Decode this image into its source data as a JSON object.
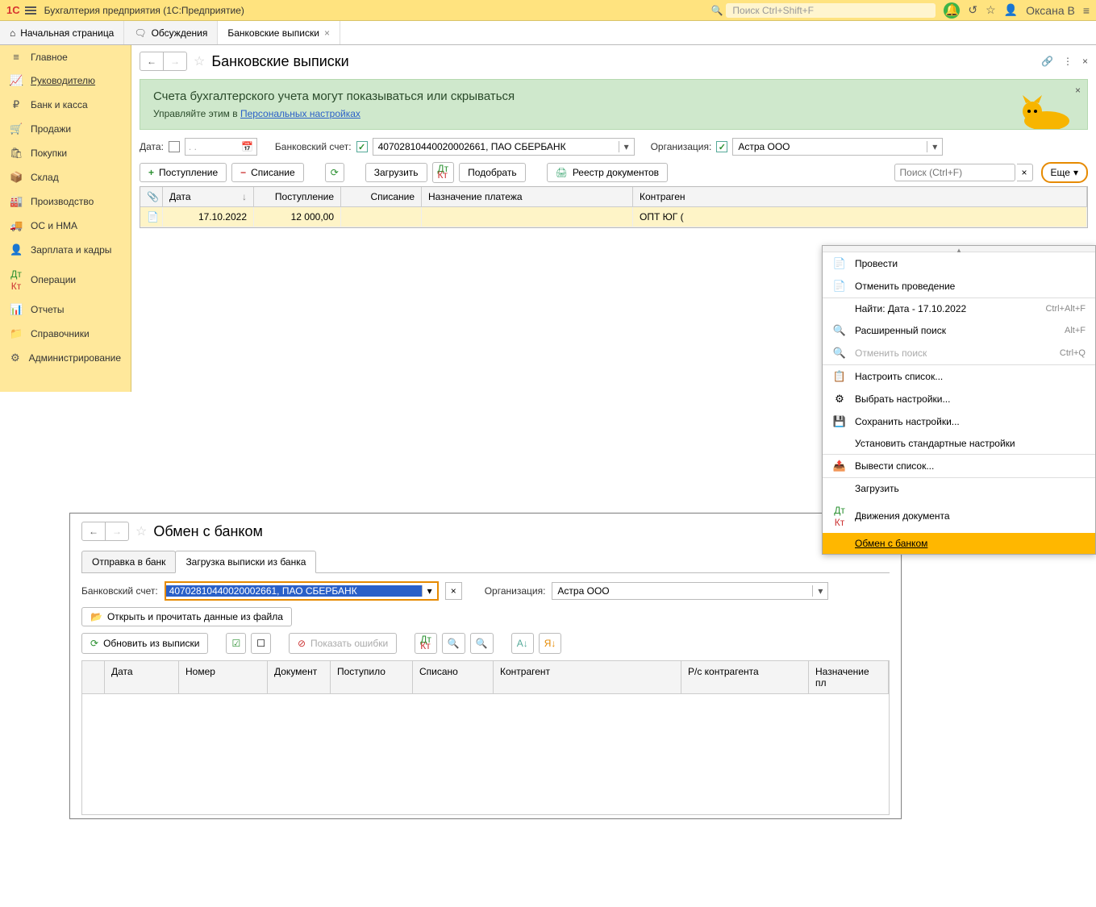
{
  "titlebar": {
    "app": "Бухгалтерия предприятия  (1С:Предприятие)",
    "search_placeholder": "Поиск Ctrl+Shift+F",
    "user": "Оксана В"
  },
  "tabs": {
    "start": "Начальная страница",
    "talk": "Обсуждения",
    "bank": "Банковские выписки"
  },
  "sidebar": {
    "items": [
      "Главное",
      "Руководителю",
      "Банк и касса",
      "Продажи",
      "Покупки",
      "Склад",
      "Производство",
      "ОС и НМА",
      "Зарплата и кадры",
      "Операции",
      "Отчеты",
      "Справочники",
      "Администрирование"
    ]
  },
  "page": {
    "title": "Банковские выписки"
  },
  "banner": {
    "title": "Счета бухгалтерского учета могут показываться или скрываться",
    "text_prefix": "Управляйте этим в ",
    "link": "Персональных настройках"
  },
  "filters": {
    "date_label": "Дата:",
    "date_placeholder": ".  .",
    "bank_label": "Банковский счет:",
    "bank_value": "40702810440020002661, ПАО СБЕРБАНК",
    "org_label": "Организация:",
    "org_value": "Астра ООО"
  },
  "toolbar": {
    "income": "Поступление",
    "outcome": "Списание",
    "load": "Загрузить",
    "pick": "Подобрать",
    "registry": "Реестр документов",
    "search_placeholder": "Поиск (Ctrl+F)",
    "more": "Еще"
  },
  "table": {
    "headers": {
      "date": "Дата",
      "in": "Поступление",
      "out": "Списание",
      "purpose": "Назначение платежа",
      "contr": "Контраген"
    },
    "rows": [
      {
        "date": "17.10.2022",
        "in": "12 000,00",
        "out": "",
        "purpose": "",
        "contr": "ОПТ ЮГ ("
      }
    ]
  },
  "menu": {
    "post": "Провести",
    "unpost": "Отменить проведение",
    "find": "Найти: Дата - 17.10.2022",
    "find_key": "Ctrl+Alt+F",
    "advfind": "Расширенный поиск",
    "advfind_key": "Alt+F",
    "cancelfind": "Отменить поиск",
    "cancelfind_key": "Ctrl+Q",
    "setuplist": "Настроить список...",
    "choosesettings": "Выбрать настройки...",
    "savesettings": "Сохранить настройки...",
    "defaultsettings": "Установить стандартные настройки",
    "outputlist": "Вывести список...",
    "load": "Загрузить",
    "movements": "Движения документа",
    "exchange": "Обмен с банком"
  },
  "window2": {
    "title": "Обмен с банком",
    "tab_send": "Отправка в банк",
    "tab_load": "Загрузка выписки из банка",
    "bank_label": "Банковский счет:",
    "bank_value": "40702810440020002661, ПАО СБЕРБАНК",
    "org_label": "Организация:",
    "org_value": "Астра ООО",
    "open_file": "Открыть и прочитать данные из файла",
    "refresh": "Обновить из выписки",
    "show_errors": "Показать ошибки",
    "headers": {
      "date": "Дата",
      "num": "Номер",
      "doc": "Документ",
      "in": "Поступило",
      "out": "Списано",
      "contr": "Контрагент",
      "acc": "Р/с контрагента",
      "purp": "Назначение пл"
    }
  }
}
